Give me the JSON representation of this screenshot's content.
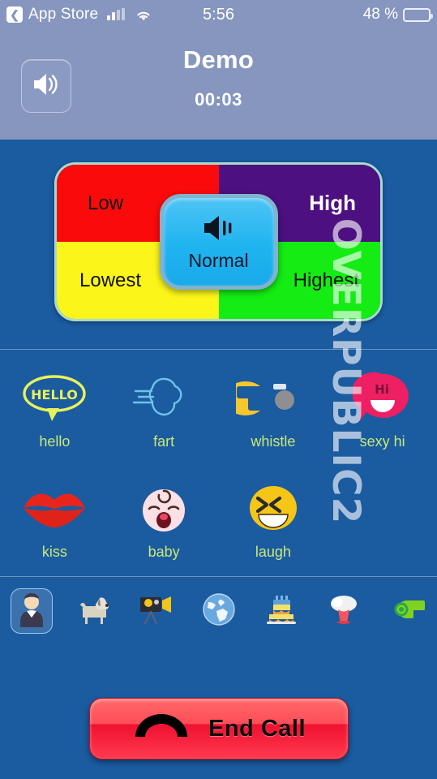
{
  "statusbar": {
    "back_label": "App Store",
    "back_icon": "chevron-left-icon",
    "signal_icon": "cellular-signal-icon",
    "wifi_icon": "wifi-icon",
    "time": "5:56",
    "battery_percent": "48 %",
    "battery_icon": "battery-icon",
    "battery_level": 48
  },
  "header": {
    "title": "Demo",
    "timer": "00:03",
    "speaker_button": {
      "icon": "speaker-loud-icon",
      "name": "speaker-toggle-button"
    },
    "background_color": "#8696bf"
  },
  "volume_panel": {
    "quadrants": [
      {
        "label": "Low",
        "color": "#fa0a0a",
        "text_color": "#111111"
      },
      {
        "label": "High",
        "color": "#4c1080",
        "text_color": "#ffffff"
      },
      {
        "label": "Lowest",
        "color": "#fbf519",
        "text_color": "#111111"
      },
      {
        "label": "Highest",
        "color": "#14ec14",
        "text_color": "#111111"
      }
    ],
    "center": {
      "label": "Normal",
      "icon": "speaker-volume-icon",
      "color": "#1fb4f0"
    }
  },
  "sounds": {
    "rows": [
      [
        {
          "label": "hello",
          "icon": "hello-speech-bubble-icon"
        },
        {
          "label": "fart",
          "icon": "fart-cloud-icon"
        },
        {
          "label": "whistle",
          "icon": "whistle-icon"
        },
        {
          "label": "sexy hi",
          "icon": "hi-speech-bubble-icon"
        }
      ],
      [
        {
          "label": "kiss",
          "icon": "lips-kiss-icon"
        },
        {
          "label": "baby",
          "icon": "baby-face-icon"
        },
        {
          "label": "laugh",
          "icon": "laughing-face-icon"
        }
      ]
    ],
    "label_color": "#c8e87a"
  },
  "categories": [
    {
      "name": "people",
      "icon": "person-icon",
      "active": true
    },
    {
      "name": "animals",
      "icon": "dog-icon",
      "active": false
    },
    {
      "name": "movies",
      "icon": "movie-camera-icon",
      "active": false
    },
    {
      "name": "world",
      "icon": "globe-icon",
      "active": false
    },
    {
      "name": "party",
      "icon": "birthday-cake-icon",
      "active": false
    },
    {
      "name": "explosion",
      "icon": "explosion-icon",
      "active": false
    },
    {
      "name": "whistles",
      "icon": "whistle-green-icon",
      "active": false
    }
  ],
  "end_call": {
    "label": "End Call",
    "icon": "phone-handset-icon",
    "color": "#f01030"
  },
  "watermark": {
    "text": "OVERPUBLIC2"
  },
  "theme": {
    "app_background": "#1b5ba0",
    "header_background": "#8696bf"
  }
}
